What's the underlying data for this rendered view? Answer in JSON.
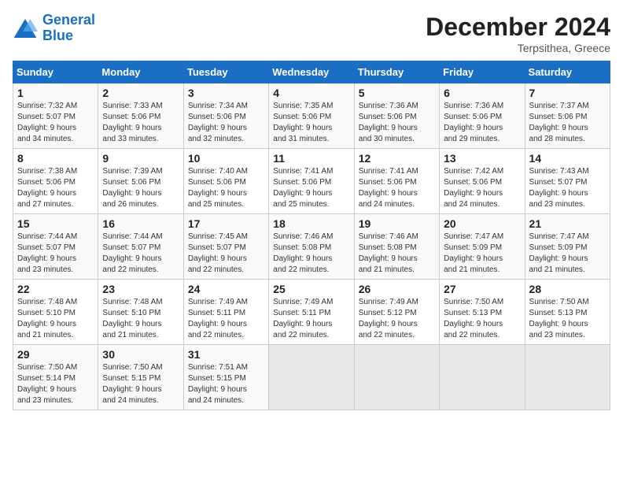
{
  "logo": {
    "text_general": "General",
    "text_blue": "Blue"
  },
  "title": "December 2024",
  "subtitle": "Terpsithea, Greece",
  "headers": [
    "Sunday",
    "Monday",
    "Tuesday",
    "Wednesday",
    "Thursday",
    "Friday",
    "Saturday"
  ],
  "weeks": [
    [
      {
        "day": "1",
        "detail": "Sunrise: 7:32 AM\nSunset: 5:07 PM\nDaylight: 9 hours\nand 34 minutes."
      },
      {
        "day": "2",
        "detail": "Sunrise: 7:33 AM\nSunset: 5:06 PM\nDaylight: 9 hours\nand 33 minutes."
      },
      {
        "day": "3",
        "detail": "Sunrise: 7:34 AM\nSunset: 5:06 PM\nDaylight: 9 hours\nand 32 minutes."
      },
      {
        "day": "4",
        "detail": "Sunrise: 7:35 AM\nSunset: 5:06 PM\nDaylight: 9 hours\nand 31 minutes."
      },
      {
        "day": "5",
        "detail": "Sunrise: 7:36 AM\nSunset: 5:06 PM\nDaylight: 9 hours\nand 30 minutes."
      },
      {
        "day": "6",
        "detail": "Sunrise: 7:36 AM\nSunset: 5:06 PM\nDaylight: 9 hours\nand 29 minutes."
      },
      {
        "day": "7",
        "detail": "Sunrise: 7:37 AM\nSunset: 5:06 PM\nDaylight: 9 hours\nand 28 minutes."
      }
    ],
    [
      {
        "day": "8",
        "detail": "Sunrise: 7:38 AM\nSunset: 5:06 PM\nDaylight: 9 hours\nand 27 minutes."
      },
      {
        "day": "9",
        "detail": "Sunrise: 7:39 AM\nSunset: 5:06 PM\nDaylight: 9 hours\nand 26 minutes."
      },
      {
        "day": "10",
        "detail": "Sunrise: 7:40 AM\nSunset: 5:06 PM\nDaylight: 9 hours\nand 25 minutes."
      },
      {
        "day": "11",
        "detail": "Sunrise: 7:41 AM\nSunset: 5:06 PM\nDaylight: 9 hours\nand 25 minutes."
      },
      {
        "day": "12",
        "detail": "Sunrise: 7:41 AM\nSunset: 5:06 PM\nDaylight: 9 hours\nand 24 minutes."
      },
      {
        "day": "13",
        "detail": "Sunrise: 7:42 AM\nSunset: 5:06 PM\nDaylight: 9 hours\nand 24 minutes."
      },
      {
        "day": "14",
        "detail": "Sunrise: 7:43 AM\nSunset: 5:07 PM\nDaylight: 9 hours\nand 23 minutes."
      }
    ],
    [
      {
        "day": "15",
        "detail": "Sunrise: 7:44 AM\nSunset: 5:07 PM\nDaylight: 9 hours\nand 23 minutes."
      },
      {
        "day": "16",
        "detail": "Sunrise: 7:44 AM\nSunset: 5:07 PM\nDaylight: 9 hours\nand 22 minutes."
      },
      {
        "day": "17",
        "detail": "Sunrise: 7:45 AM\nSunset: 5:07 PM\nDaylight: 9 hours\nand 22 minutes."
      },
      {
        "day": "18",
        "detail": "Sunrise: 7:46 AM\nSunset: 5:08 PM\nDaylight: 9 hours\nand 22 minutes."
      },
      {
        "day": "19",
        "detail": "Sunrise: 7:46 AM\nSunset: 5:08 PM\nDaylight: 9 hours\nand 21 minutes."
      },
      {
        "day": "20",
        "detail": "Sunrise: 7:47 AM\nSunset: 5:09 PM\nDaylight: 9 hours\nand 21 minutes."
      },
      {
        "day": "21",
        "detail": "Sunrise: 7:47 AM\nSunset: 5:09 PM\nDaylight: 9 hours\nand 21 minutes."
      }
    ],
    [
      {
        "day": "22",
        "detail": "Sunrise: 7:48 AM\nSunset: 5:10 PM\nDaylight: 9 hours\nand 21 minutes."
      },
      {
        "day": "23",
        "detail": "Sunrise: 7:48 AM\nSunset: 5:10 PM\nDaylight: 9 hours\nand 21 minutes."
      },
      {
        "day": "24",
        "detail": "Sunrise: 7:49 AM\nSunset: 5:11 PM\nDaylight: 9 hours\nand 22 minutes."
      },
      {
        "day": "25",
        "detail": "Sunrise: 7:49 AM\nSunset: 5:11 PM\nDaylight: 9 hours\nand 22 minutes."
      },
      {
        "day": "26",
        "detail": "Sunrise: 7:49 AM\nSunset: 5:12 PM\nDaylight: 9 hours\nand 22 minutes."
      },
      {
        "day": "27",
        "detail": "Sunrise: 7:50 AM\nSunset: 5:13 PM\nDaylight: 9 hours\nand 22 minutes."
      },
      {
        "day": "28",
        "detail": "Sunrise: 7:50 AM\nSunset: 5:13 PM\nDaylight: 9 hours\nand 23 minutes."
      }
    ],
    [
      {
        "day": "29",
        "detail": "Sunrise: 7:50 AM\nSunset: 5:14 PM\nDaylight: 9 hours\nand 23 minutes."
      },
      {
        "day": "30",
        "detail": "Sunrise: 7:50 AM\nSunset: 5:15 PM\nDaylight: 9 hours\nand 24 minutes."
      },
      {
        "day": "31",
        "detail": "Sunrise: 7:51 AM\nSunset: 5:15 PM\nDaylight: 9 hours\nand 24 minutes."
      },
      {
        "day": "",
        "detail": ""
      },
      {
        "day": "",
        "detail": ""
      },
      {
        "day": "",
        "detail": ""
      },
      {
        "day": "",
        "detail": ""
      }
    ]
  ]
}
